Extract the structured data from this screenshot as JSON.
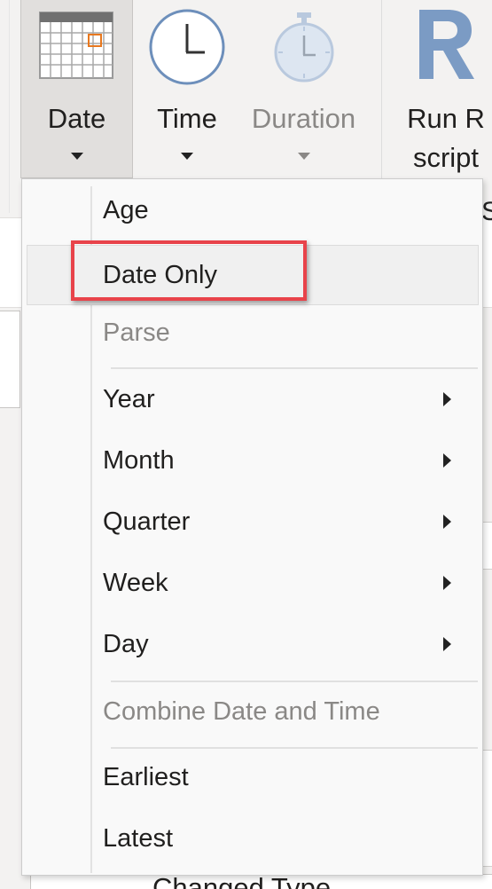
{
  "ribbon": {
    "buttons": [
      {
        "label": "Date",
        "icon": "calendar-icon"
      },
      {
        "label": "Time",
        "icon": "clock-icon"
      },
      {
        "label": "Duration",
        "icon": "stopwatch-icon"
      },
      {
        "label_line1": "Run R",
        "label_line2": "script",
        "icon": "r-script-icon"
      }
    ],
    "cut_label": "S"
  },
  "menu": {
    "items": [
      {
        "label": "Age"
      },
      {
        "label": "Date Only"
      },
      {
        "label": "Parse"
      },
      {
        "label": "Year"
      },
      {
        "label": "Month"
      },
      {
        "label": "Quarter"
      },
      {
        "label": "Week"
      },
      {
        "label": "Day"
      },
      {
        "label": "Combine Date and Time"
      },
      {
        "label": "Earliest"
      },
      {
        "label": "Latest"
      }
    ]
  },
  "background": {
    "applied_step": "Changed Type"
  },
  "colors": {
    "highlight": "#e8434a",
    "r_logo": "#7b9bc4",
    "calendar_accent": "#e8781e"
  }
}
